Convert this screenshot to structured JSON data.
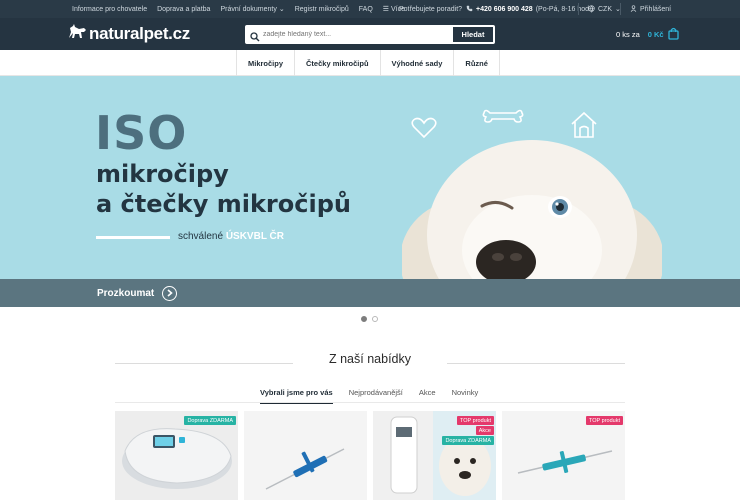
{
  "topbar": {
    "links": [
      "Informace pro chovatele",
      "Doprava a platba",
      "Právní dokumenty",
      "Registr mikročipů",
      "FAQ",
      "Více"
    ],
    "advice_label": "Potřebujete poradit?",
    "phone": "+420 606 900 428",
    "hours": "(Po-Pá, 8-16 hod.)",
    "currency": "CZK",
    "login": "Přihlášení"
  },
  "header": {
    "logo_text": "naturalpet.cz",
    "search_placeholder": "zadejte hledaný text...",
    "search_button": "Hledat",
    "cart_count": "0 ks za",
    "cart_price": "0 Kč"
  },
  "nav": {
    "items": [
      "Mikročipy",
      "Čtečky mikročipů",
      "Výhodné sady",
      "Různé"
    ]
  },
  "hero": {
    "big": "ISO",
    "line1": "mikročipy",
    "line2": "a čtečky mikročipů",
    "tag_prefix": "schválené",
    "tag_highlight": "ÚSKVBL ČR",
    "cta": "Prozkoumat"
  },
  "section": {
    "title": "Z naší nabídky",
    "tabs": [
      "Vybrali jsme pro vás",
      "Nejprodávanější",
      "Akce",
      "Novinky"
    ],
    "active_tab": 0
  },
  "products": [
    {
      "badges": [
        "Doprava ZDARMA"
      ]
    },
    {
      "badges": []
    },
    {
      "badges": [
        "TOP produkt",
        "Akce",
        "Doprava ZDARMA"
      ]
    },
    {
      "badges": [
        "TOP produkt"
      ]
    }
  ],
  "colors": {
    "topbar_bg": "#2a3a47",
    "header_bg": "#253441",
    "hero_bg": "#a9dce6",
    "accent_blue": "#2fb4d8",
    "badge_free": "#27b3a4",
    "badge_top": "#e4396b"
  }
}
